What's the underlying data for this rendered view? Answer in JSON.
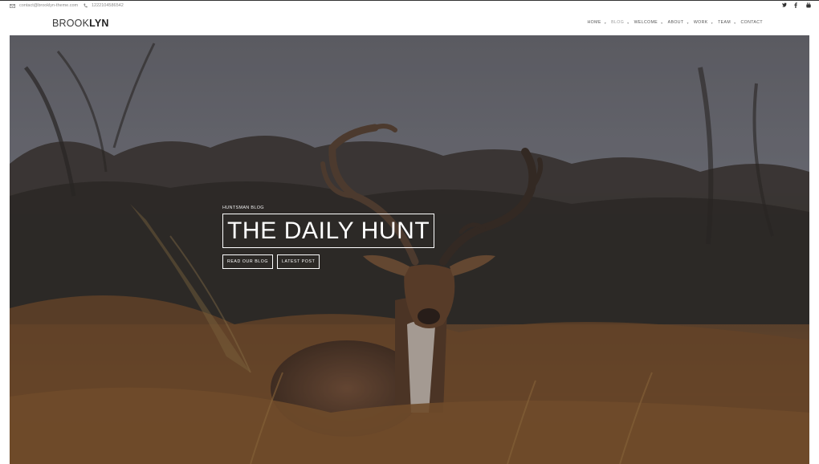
{
  "topbar": {
    "email": "contact@brooklyn-theme.com",
    "phone": "1222104586542",
    "socials": [
      {
        "icon": "twitter-icon"
      },
      {
        "icon": "facebook-icon"
      },
      {
        "icon": "youtube-icon"
      }
    ]
  },
  "header": {
    "logo_light": "BROOK",
    "logo_bold": "LYN",
    "nav": [
      {
        "label": "HOME",
        "has_dropdown": true
      },
      {
        "label": "BLOG",
        "has_dropdown": true,
        "active": true
      },
      {
        "label": "WELCOME",
        "has_dropdown": true
      },
      {
        "label": "ABOUT",
        "has_dropdown": true
      },
      {
        "label": "WORK",
        "has_dropdown": true
      },
      {
        "label": "TEAM",
        "has_dropdown": true
      },
      {
        "label": "CONTACT",
        "has_dropdown": false
      }
    ]
  },
  "hero": {
    "eyebrow": "HUNTSMAN BLOG",
    "title": "THE DAILY HUNT",
    "buttons": {
      "read_blog": "READ OUR BLOG",
      "latest_post": "LATEST POST"
    },
    "colors": {
      "accent": "#ffffff",
      "field": "#8a5a2b"
    }
  }
}
